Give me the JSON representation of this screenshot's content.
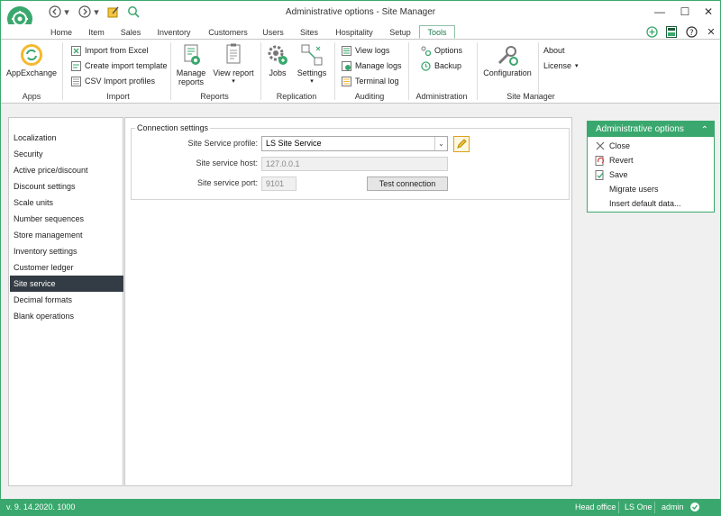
{
  "window": {
    "title": "Administrative options - Site Manager",
    "controls": {
      "minimize": "—",
      "maximize": "☐",
      "close": "✕"
    }
  },
  "quick_access": [
    "back-icon",
    "dropdown-icon",
    "forward-icon",
    "dropdown-icon",
    "edit-icon",
    "search-icon"
  ],
  "tabs": [
    {
      "label": "Home"
    },
    {
      "label": "Item"
    },
    {
      "label": "Sales"
    },
    {
      "label": "Inventory"
    },
    {
      "label": "Customers"
    },
    {
      "label": "Users"
    },
    {
      "label": "Sites"
    },
    {
      "label": "Hospitality"
    },
    {
      "label": "Setup"
    },
    {
      "label": "Tools",
      "active": true
    }
  ],
  "ribbon": {
    "apps": {
      "group": "Apps",
      "appexchange": "AppExchange"
    },
    "import": {
      "group": "Import",
      "items": [
        "Import from Excel",
        "Create import template",
        "CSV Import profiles"
      ]
    },
    "reports": {
      "group": "Reports",
      "manage": "Manage\nreports",
      "manage_line1": "Manage",
      "manage_line2": "reports",
      "view": "View report"
    },
    "replication": {
      "group": "Replication",
      "jobs": "Jobs",
      "settings": "Settings"
    },
    "auditing": {
      "group": "Auditing",
      "items": [
        "View logs",
        "Manage logs",
        "Terminal log"
      ]
    },
    "administration": {
      "group": "Administration",
      "items": [
        "Options",
        "Backup"
      ]
    },
    "site_manager": {
      "group": "Site Manager",
      "configuration": "Configuration",
      "about": "About",
      "license": "License"
    }
  },
  "nav": {
    "items": [
      "Localization",
      "Security",
      "Active price/discount",
      "Discount settings",
      "Scale units",
      "Number sequences",
      "Store management",
      "Inventory settings",
      "Customer ledger",
      "Site service",
      "Decimal formats",
      "Blank operations"
    ],
    "active_index": 9
  },
  "connection": {
    "legend": "Connection settings",
    "profile_label": "Site Service profile:",
    "profile_value": "LS Site Service",
    "host_label": "Site service host:",
    "host_value": "127.0.0.1",
    "port_label": "Site service port:",
    "port_value": "9101",
    "test_button": "Test connection"
  },
  "actions_panel": {
    "title": "Administrative options",
    "items": [
      {
        "label": "Close",
        "icon": "close-icon"
      },
      {
        "label": "Revert",
        "icon": "revert-icon"
      },
      {
        "label": "Save",
        "icon": "save-icon"
      },
      {
        "label": "Migrate users",
        "icon": ""
      },
      {
        "label": "Insert default data...",
        "icon": ""
      }
    ]
  },
  "status": {
    "version": "v. 9. 14.2020. 1000",
    "office": "Head office",
    "product": "LS One",
    "user": "admin"
  },
  "colors": {
    "accent": "#3aa86e",
    "nav_active": "#333c44"
  }
}
